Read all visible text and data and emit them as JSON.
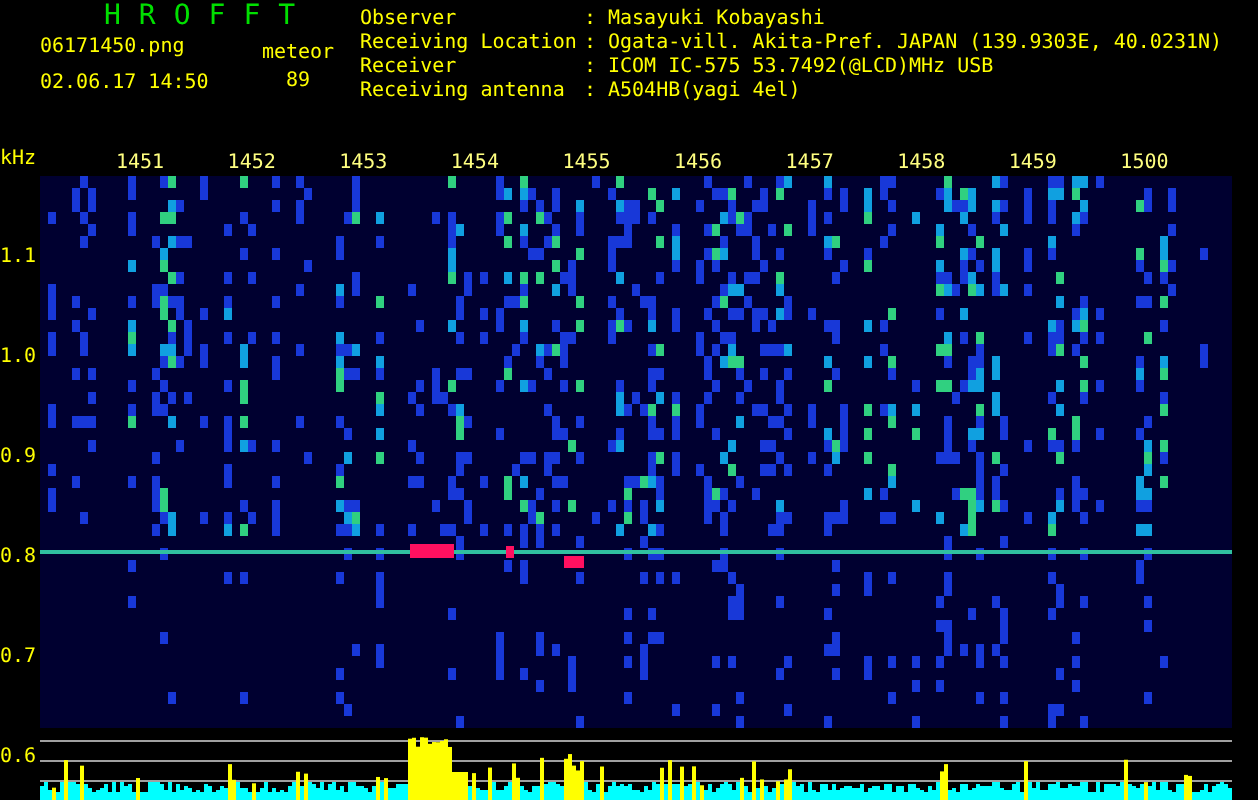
{
  "header": {
    "title": "HROFFT",
    "filename": "06171450.png",
    "datetime": "02.06.17 14:50",
    "meteor_label": "meteor",
    "meteor_count": "89"
  },
  "info": [
    {
      "label": "Observer",
      "separator": ":",
      "value": "Masayuki Kobayashi"
    },
    {
      "label": "Receiving Location",
      "separator": ":",
      "value": "Ogata-vill. Akita-Pref. JAPAN (139.9303E, 40.0231N)"
    },
    {
      "label": "Receiver",
      "separator": ":",
      "value": "ICOM IC-575 53.7492(@LCD)MHz USB"
    },
    {
      "label": "Receiving antenna",
      "separator": ":",
      "value": "A504HB(yagi 4el)"
    }
  ],
  "plot": {
    "unit": "kHz",
    "x_ticks": [
      "1451",
      "1452",
      "1453",
      "1454",
      "1455",
      "1456",
      "1457",
      "1458",
      "1459",
      "1500"
    ],
    "y_ticks": [
      "1.1",
      "1.0",
      "0.9",
      "0.8",
      "0.7",
      "0.6"
    ]
  }
}
